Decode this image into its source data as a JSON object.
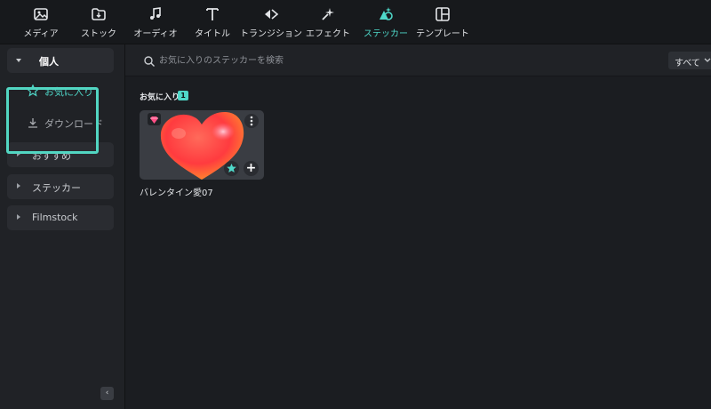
{
  "toolbar": {
    "tabs": [
      {
        "label": "メディア",
        "icon": "media-icon"
      },
      {
        "label": "ストック",
        "icon": "stock-folder-icon"
      },
      {
        "label": "オーディオ",
        "icon": "music-note-icon"
      },
      {
        "label": "タイトル",
        "icon": "title-t-icon"
      },
      {
        "label": "トランジション",
        "icon": "transition-arrows-icon"
      },
      {
        "label": "エフェクト",
        "icon": "effects-sparkle-icon"
      },
      {
        "label": "ステッカー",
        "icon": "sticker-icon"
      },
      {
        "label": "テンプレート",
        "icon": "template-icon"
      }
    ],
    "active_tab": "ステッカー"
  },
  "sidebar": {
    "personal": {
      "label": "個人",
      "expanded": true
    },
    "favorites": {
      "label": "お気に入り",
      "selected": true
    },
    "download": {
      "label": "ダウンロード"
    },
    "groups": [
      {
        "label": "おすすめ"
      },
      {
        "label": "ステッカー"
      },
      {
        "label": "Filmstock"
      }
    ],
    "collapse_label": "‹"
  },
  "search": {
    "placeholder": "お気に入りのステッカーを検索",
    "value": ""
  },
  "filter": {
    "selected": "すべて"
  },
  "section": {
    "title": "お気に入り",
    "count": "1"
  },
  "items": [
    {
      "name": "バレンタイン愛07",
      "premium": true,
      "favorited": true,
      "add_label": "+"
    }
  ],
  "colors": {
    "accent": "#4fd8c9",
    "highlight_box": "#52d6c2",
    "background": "#1b1d21",
    "sidebar": "#202226"
  }
}
